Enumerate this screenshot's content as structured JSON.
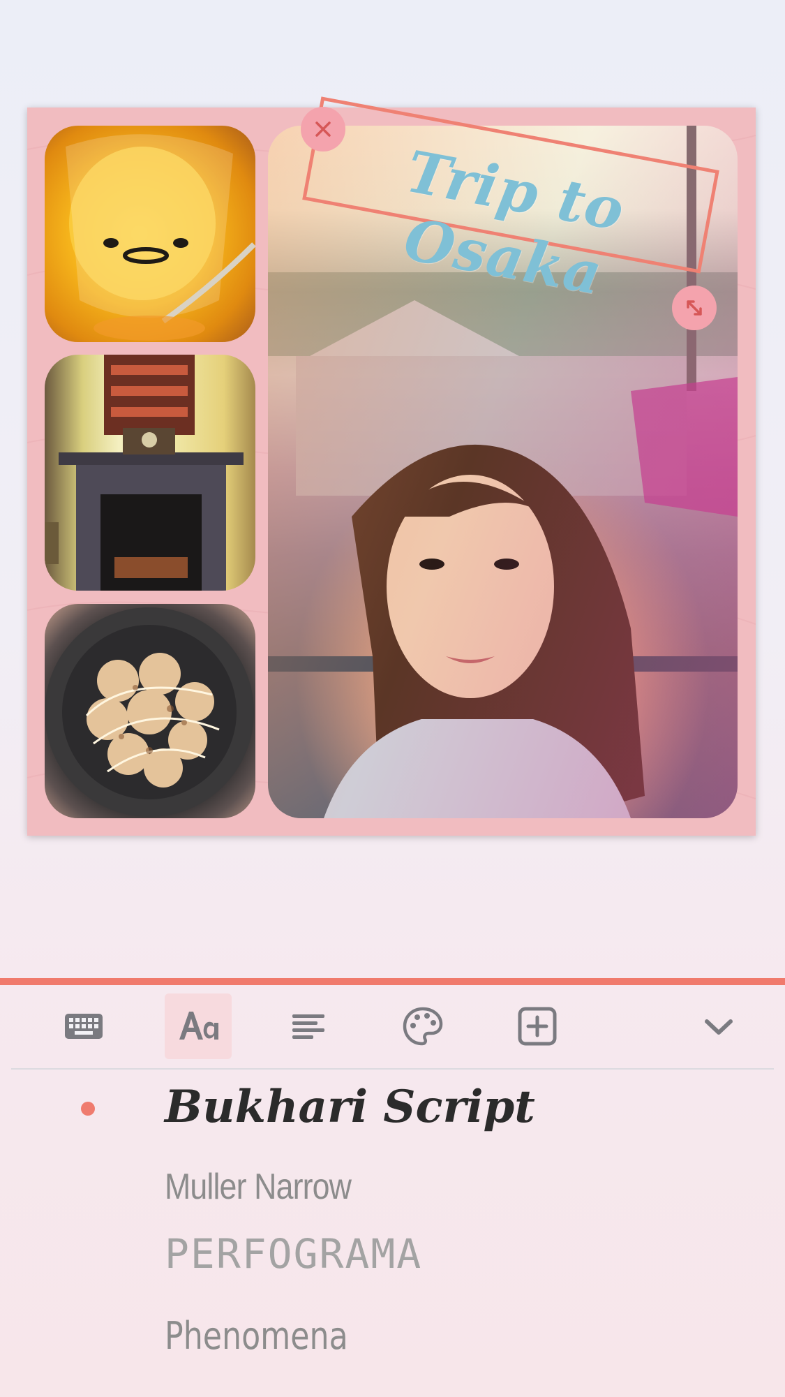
{
  "collage": {
    "sticker_text": "Trip to Osaka",
    "colors": {
      "frame": "#f1bcc0",
      "sticker_border": "#ef8173",
      "sticker_text": "#7fc0d6",
      "handle": "#f4a3ad"
    },
    "photos": [
      {
        "subject": "pudding-dessert"
      },
      {
        "subject": "fireplace-room"
      },
      {
        "subject": "takoyaki-plate"
      },
      {
        "subject": "selfie-at-harbor"
      }
    ]
  },
  "toolbar": {
    "accent": "#f07a6c",
    "active_tool": "font",
    "tools": [
      {
        "icon": "keyboard-icon"
      },
      {
        "icon": "font-icon"
      },
      {
        "icon": "align-left-icon"
      },
      {
        "icon": "palette-icon"
      },
      {
        "icon": "add-box-icon"
      },
      {
        "icon": "chevron-down-icon"
      }
    ]
  },
  "fonts": {
    "selected_index": 0,
    "items": [
      {
        "label": "Bukhari Script"
      },
      {
        "label": "Muller Narrow"
      },
      {
        "label": "PERFOGRAMA"
      },
      {
        "label": "Phenomena"
      }
    ]
  }
}
